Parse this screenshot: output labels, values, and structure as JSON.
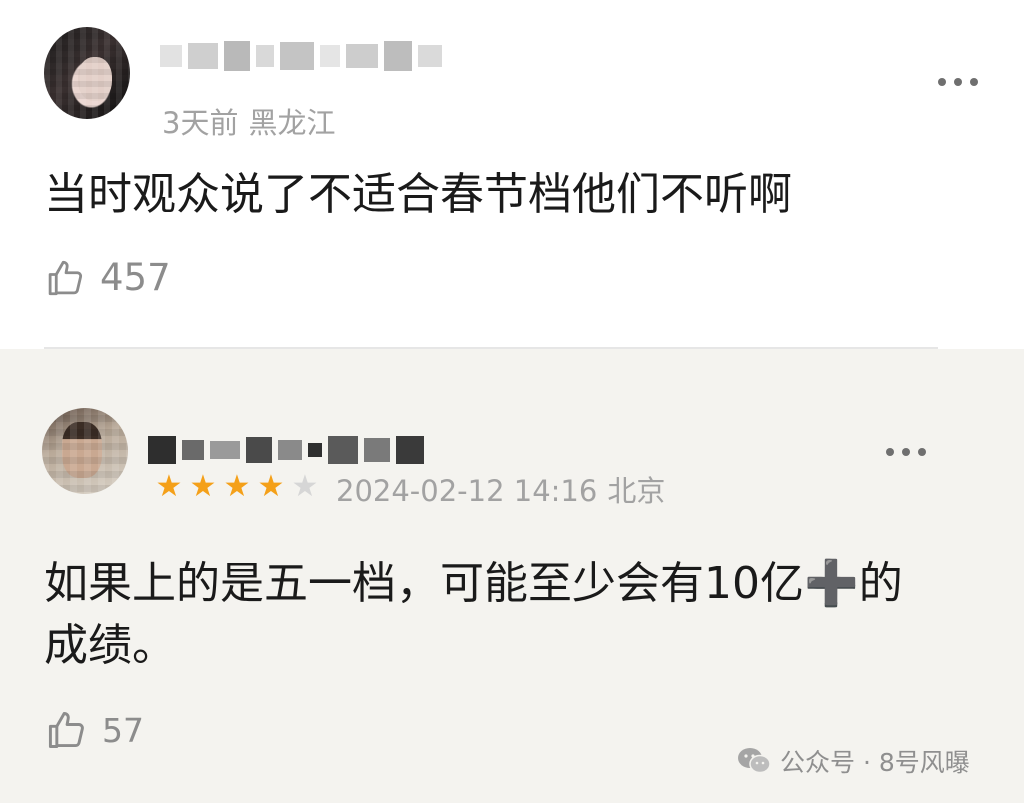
{
  "comments": [
    {
      "time": "3天前",
      "location": "黑龙江",
      "text": "当时观众说了不适合春节档他们不听啊",
      "likes": "457"
    },
    {
      "rating": 4,
      "rating_max": 5,
      "stars": [
        "★",
        "★",
        "★",
        "★",
        "★"
      ],
      "time": "2024-02-12 14:16",
      "location": "北京",
      "text": "如果上的是五一档，可能至少会有10亿➕的成绩。",
      "likes": "57"
    }
  ],
  "watermark": {
    "text": "公众号 · 8号风曝",
    "icon": "wechat-icon"
  },
  "colors": {
    "star_on": "#f4a019",
    "star_off": "#d6d6d6",
    "meta_gray": "#a2a2a2",
    "second_bg": "#f4f3ef"
  }
}
